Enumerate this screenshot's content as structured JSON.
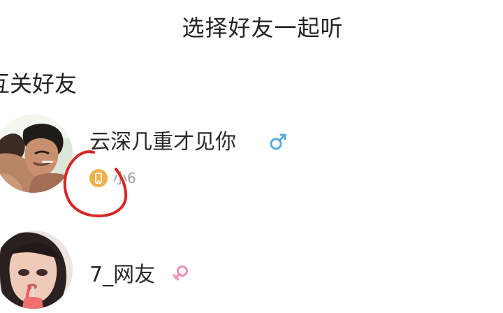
{
  "header": {
    "title": "选择好友一起听"
  },
  "section": {
    "title": "互关好友"
  },
  "friends": [
    {
      "name": "云深几重才见你",
      "gender_icon": "male-icon",
      "gender_color": "#5aa8df",
      "device_icon": "phone-icon",
      "device_color": "#eeb24a",
      "device_label": "小6"
    },
    {
      "name": "7_网友",
      "gender_icon": "female-icon",
      "gender_color": "#f18db2"
    }
  ],
  "annotation": {
    "color": "#d82626"
  }
}
